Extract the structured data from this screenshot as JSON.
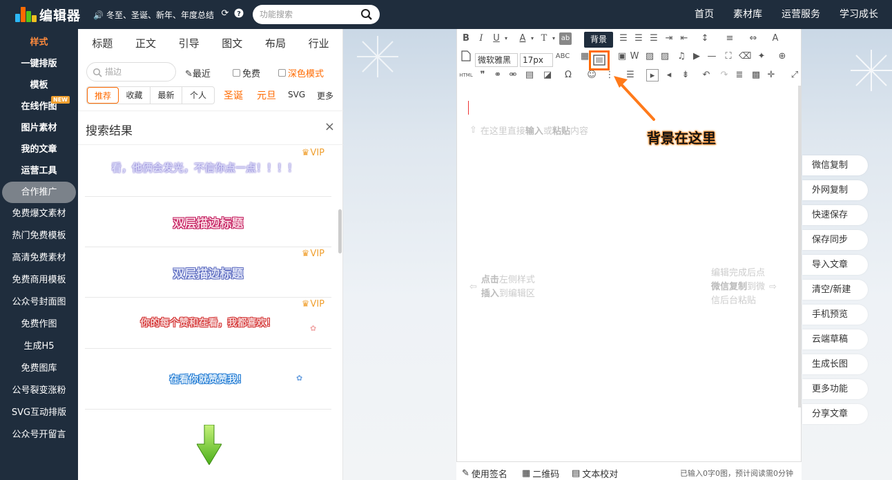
{
  "header": {
    "logo_text": "编辑器",
    "notice": "冬至、圣诞、新年、年度总结",
    "search_placeholder": "功能搜索",
    "nav": [
      "首页",
      "素材库",
      "运营服务",
      "学习成长"
    ]
  },
  "sidebar": {
    "items": [
      {
        "label": "样式",
        "active": true
      },
      {
        "label": "一键排版"
      },
      {
        "label": "模板"
      },
      {
        "label": "在线作图",
        "badge": "NEW"
      },
      {
        "label": "图片素材"
      },
      {
        "label": "我的文章"
      },
      {
        "label": "运营工具"
      },
      {
        "label": "合作推广",
        "pill": true
      },
      {
        "label": "免费爆文素材"
      },
      {
        "label": "热门免费模板"
      },
      {
        "label": "高清免费素材"
      },
      {
        "label": "免费商用模板"
      },
      {
        "label": "公众号封面图"
      },
      {
        "label": "免费作图"
      },
      {
        "label": "生成H5"
      },
      {
        "label": "免费图库"
      },
      {
        "label": "公号裂变涨粉"
      },
      {
        "label": "SVG互动排版"
      },
      {
        "label": "公众号开留言"
      }
    ]
  },
  "panel": {
    "category_tabs": [
      "标题",
      "正文",
      "引导",
      "图文",
      "布局",
      "行业"
    ],
    "search_value": "",
    "search_placeholder": "描边",
    "recent_label": "最近",
    "free_label": "免费",
    "dark_label": "深色模式",
    "filter_tabs": [
      "推荐",
      "收藏",
      "最新",
      "个人"
    ],
    "festival_tags": [
      "圣诞",
      "元旦"
    ],
    "svg_label": "SVG",
    "more_label": "更多",
    "result_title": "搜索结果",
    "close_symbol": "×",
    "results": [
      {
        "text": "看，他俩会发光，不信你点一点！！！！",
        "vip": true
      },
      {
        "text": "双层描边标题",
        "vip": false
      },
      {
        "text": "双层描边标题",
        "vip": true
      },
      {
        "text": "你的每个赞和在看，我都喜欢！",
        "vip": true
      },
      {
        "text": "在看你就赞赞我！",
        "vip": false
      },
      {
        "text": "",
        "vip": false
      }
    ],
    "vip_label": "VIP"
  },
  "toolbar": {
    "font_family": "微软雅黑",
    "font_size": "17px",
    "tooltip": "背景",
    "html_label": "HTML"
  },
  "editor": {
    "input_hint_pre": "在这里直接",
    "input_hint_b1": "输入",
    "input_hint_mid": "或",
    "input_hint_b2": "粘贴",
    "input_hint_post": "内容",
    "annotation": "背景在这里",
    "left_hint_l1_b": "点击",
    "left_hint_l1": "左侧样式",
    "left_hint_l2_b": "插入",
    "left_hint_l2": "到编辑区",
    "right_hint_l1": "编辑完成后点",
    "right_hint_l2_b": "微信复制",
    "right_hint_l2": "到微",
    "right_hint_l3": "信后台粘贴"
  },
  "side_buttons": [
    "微信复制",
    "外网复制",
    "快速保存",
    "保存同步",
    "导入文章",
    "清空/新建",
    "手机预览",
    "云端草稿",
    "生成长图",
    "更多功能",
    "分享文章"
  ],
  "bottom_bar": {
    "signature": "使用签名",
    "qrcode": "二维码",
    "proofread": "文本校对",
    "stats": "已输入0字0图，预计阅读需0分钟"
  },
  "colors": {
    "dark_nav": "#1f2d3d",
    "accent": "#ff6a00",
    "vip": "#f0a030"
  }
}
